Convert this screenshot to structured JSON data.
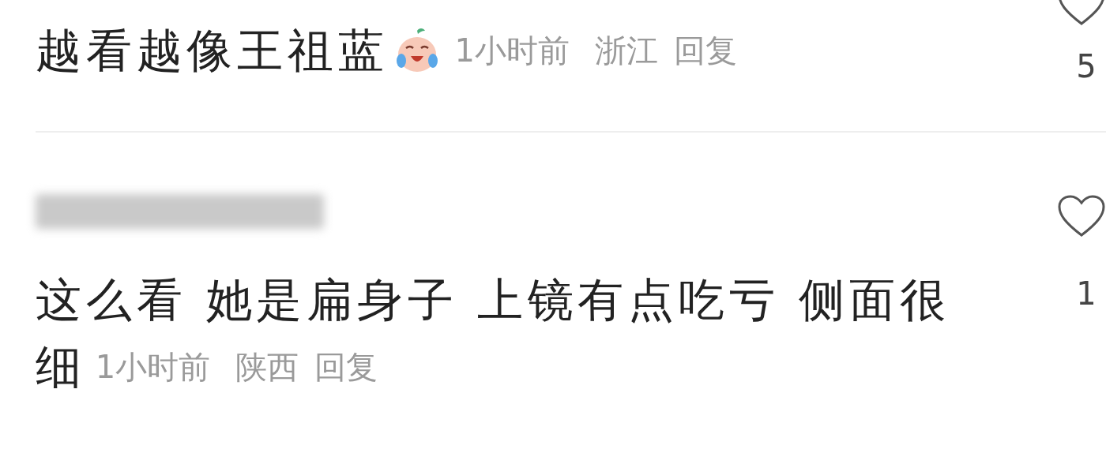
{
  "comments": [
    {
      "author_blurred": false,
      "lines": [
        "越看越像王祖蓝"
      ],
      "emoji": true,
      "time": "1小时前",
      "location": "浙江",
      "reply": "回复",
      "likes": "5"
    },
    {
      "author_blurred": true,
      "lines": [
        "这么看 她是扁身子 上镜有点吃亏 侧面很",
        "细"
      ],
      "emoji": false,
      "time": "1小时前",
      "location": "陕西",
      "reply": "回复",
      "likes": "1"
    }
  ]
}
